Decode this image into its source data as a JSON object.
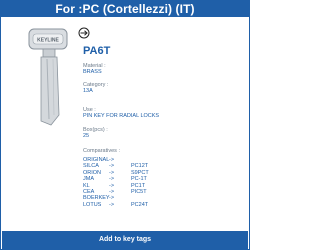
{
  "header": {
    "title": "For :PC (Cortellezzi)  (IT)"
  },
  "product": {
    "code": "PA6T",
    "key_image_icon": "key-blank-image",
    "direction_icon": "circle-arrow-right-icon",
    "material_label": "Material :",
    "material_value": "BRASS",
    "category_label": "Category :",
    "category_value": "13A",
    "use_label": "Use :",
    "use_value": "PIN KEY FOR RADIAL LOCKS",
    "box_label": "Box(pcs) :",
    "box_value": "25",
    "comparatives_label": "Comparatives :"
  },
  "comparatives": [
    {
      "brand": "ORIGINAL",
      "arrow": "->",
      "code": ""
    },
    {
      "brand": "SILCA",
      "arrow": "->",
      "code": "PC12T"
    },
    {
      "brand": "ORION",
      "arrow": "->",
      "code": "S9PCT"
    },
    {
      "brand": "JMA",
      "arrow": "->",
      "code": "PC-1T"
    },
    {
      "brand": "KL",
      "arrow": "->",
      "code": "PC1T"
    },
    {
      "brand": "CEA",
      "arrow": "->",
      "code": "PIC5T"
    },
    {
      "brand": "BOERKEY",
      "arrow": "->",
      "code": ""
    },
    {
      "brand": "LOTUS",
      "arrow": "->",
      "code": "PC24T"
    }
  ],
  "footer": {
    "button_label": "Add to key tags"
  },
  "colors": {
    "accent": "#1f5fa8",
    "label_gray": "#6b7a8a"
  }
}
